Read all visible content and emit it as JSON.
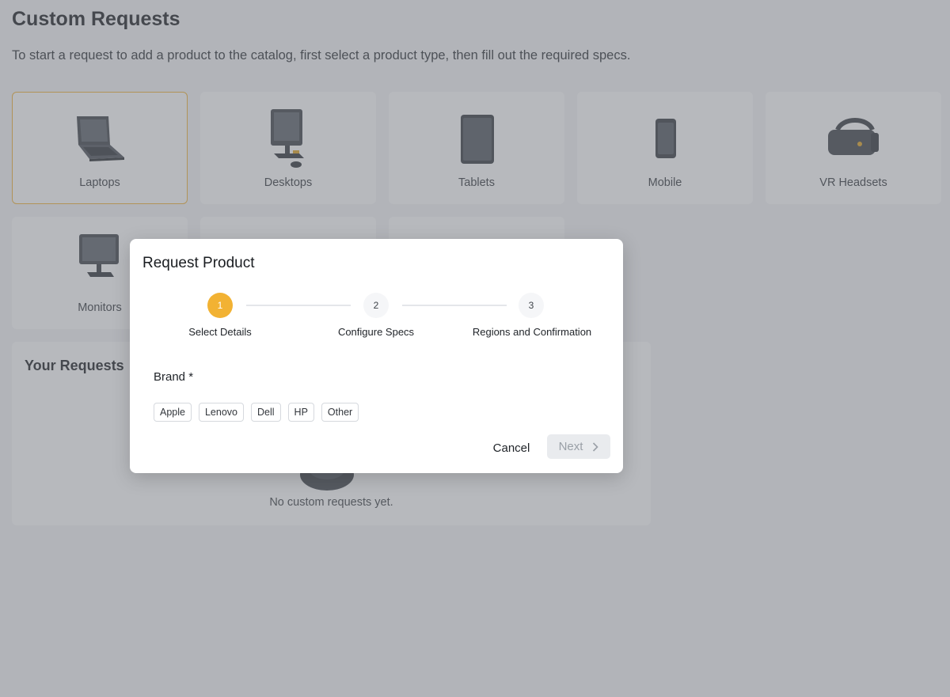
{
  "header": {
    "title": "Custom Requests",
    "subtitle": "To start a request to add a product to the catalog, first select a product type, then fill out the required specs."
  },
  "product_types": [
    {
      "label": "Laptops",
      "icon": "laptop-icon",
      "selected": true
    },
    {
      "label": "Desktops",
      "icon": "desktop-icon",
      "selected": false
    },
    {
      "label": "Tablets",
      "icon": "tablet-icon",
      "selected": false
    },
    {
      "label": "Mobile",
      "icon": "mobile-icon",
      "selected": false
    },
    {
      "label": "VR Headsets",
      "icon": "vr-headset-icon",
      "selected": false
    },
    {
      "label": "Monitors",
      "icon": "monitor-icon",
      "selected": false
    }
  ],
  "requests": {
    "title": "Your Requests",
    "empty_message": "No custom requests yet."
  },
  "modal": {
    "title": "Request Product",
    "steps": [
      {
        "number": "1",
        "label": "Select Details",
        "active": true
      },
      {
        "number": "2",
        "label": "Configure Specs",
        "active": false
      },
      {
        "number": "3",
        "label": "Regions and Confirmation",
        "active": false
      }
    ],
    "brand_label": "Brand *",
    "brands": [
      "Apple",
      "Lenovo",
      "Dell",
      "HP",
      "Other"
    ],
    "cancel_label": "Cancel",
    "next_label": "Next"
  },
  "colors": {
    "accent": "#f2b233",
    "overlay": "#70747c"
  }
}
